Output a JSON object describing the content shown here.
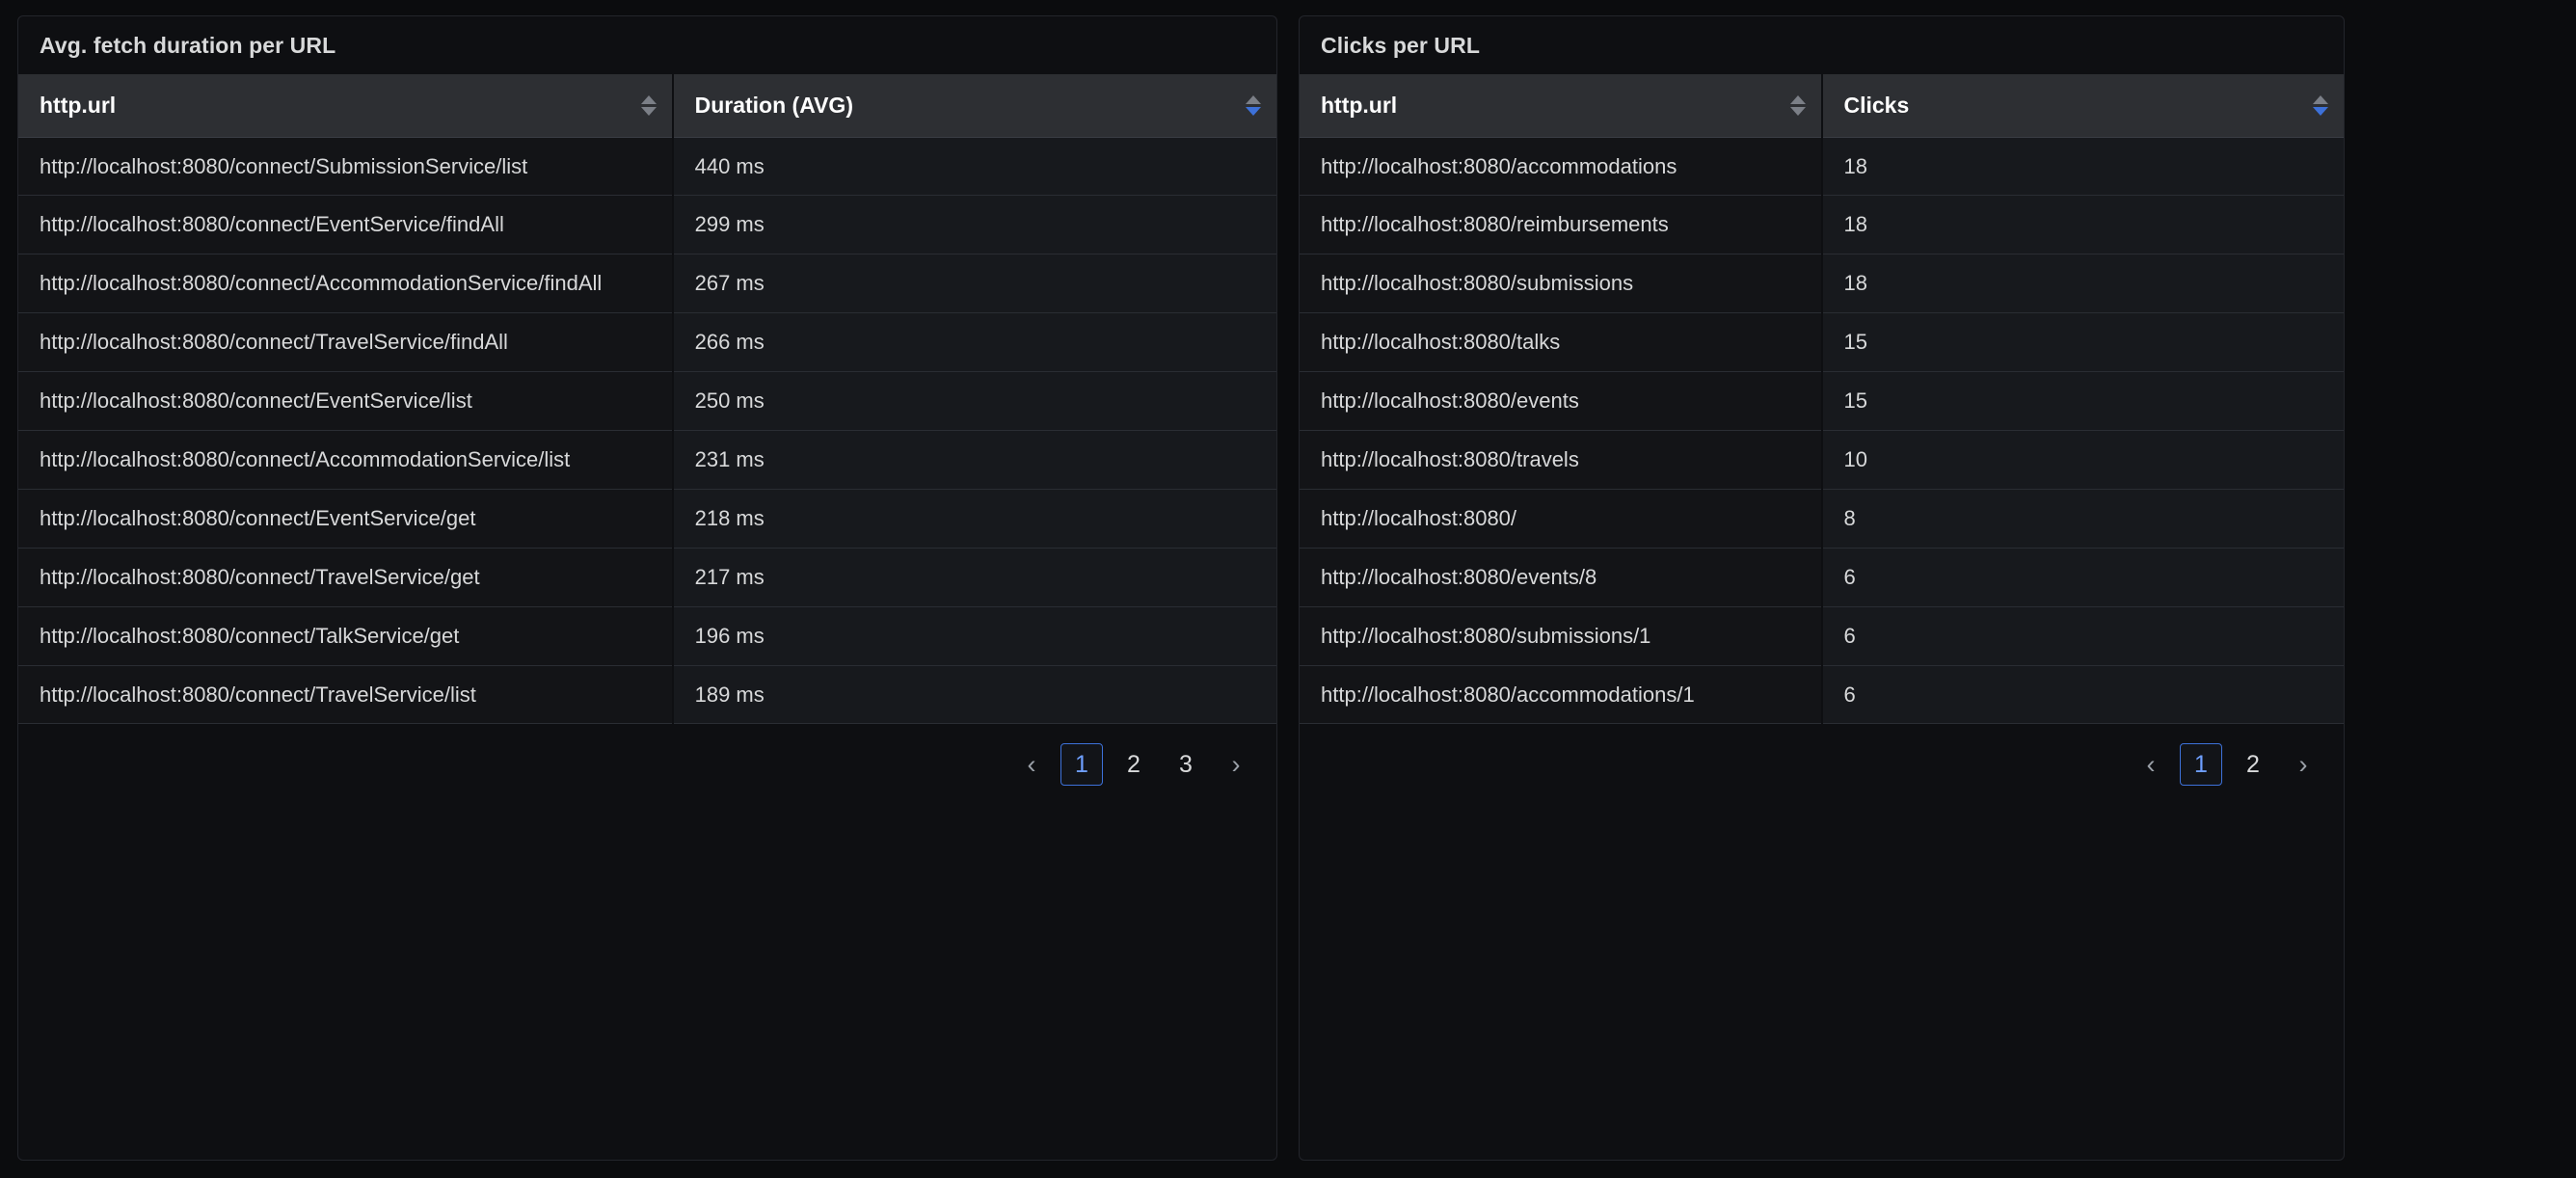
{
  "background_color": "#0b0c0e",
  "accent_color": "#3d71d9",
  "panels": [
    {
      "title": "Avg. fetch duration per URL",
      "columns": [
        {
          "label": "http.url",
          "sort": "none"
        },
        {
          "label": "Duration (AVG)",
          "sort": "desc"
        }
      ],
      "rows": [
        {
          "url": "http://localhost:8080/connect/SubmissionService/list",
          "value": "440 ms"
        },
        {
          "url": "http://localhost:8080/connect/EventService/findAll",
          "value": "299 ms"
        },
        {
          "url": "http://localhost:8080/connect/AccommodationService/findAll",
          "value": "267 ms"
        },
        {
          "url": "http://localhost:8080/connect/TravelService/findAll",
          "value": "266 ms"
        },
        {
          "url": "http://localhost:8080/connect/EventService/list",
          "value": "250 ms"
        },
        {
          "url": "http://localhost:8080/connect/AccommodationService/list",
          "value": "231 ms"
        },
        {
          "url": "http://localhost:8080/connect/EventService/get",
          "value": "218 ms"
        },
        {
          "url": "http://localhost:8080/connect/TravelService/get",
          "value": "217 ms"
        },
        {
          "url": "http://localhost:8080/connect/TalkService/get",
          "value": "196 ms"
        },
        {
          "url": "http://localhost:8080/connect/TravelService/list",
          "value": "189 ms"
        }
      ],
      "pagination": {
        "prev_label": "‹",
        "next_label": "›",
        "pages": [
          "1",
          "2",
          "3"
        ],
        "current": "1"
      }
    },
    {
      "title": "Clicks per URL",
      "columns": [
        {
          "label": "http.url",
          "sort": "none"
        },
        {
          "label": "Clicks",
          "sort": "desc"
        }
      ],
      "rows": [
        {
          "url": "http://localhost:8080/accommodations",
          "value": "18"
        },
        {
          "url": "http://localhost:8080/reimbursements",
          "value": "18"
        },
        {
          "url": "http://localhost:8080/submissions",
          "value": "18"
        },
        {
          "url": "http://localhost:8080/talks",
          "value": "15"
        },
        {
          "url": "http://localhost:8080/events",
          "value": "15"
        },
        {
          "url": "http://localhost:8080/travels",
          "value": "10"
        },
        {
          "url": "http://localhost:8080/",
          "value": "8"
        },
        {
          "url": "http://localhost:8080/events/8",
          "value": "6"
        },
        {
          "url": "http://localhost:8080/submissions/1",
          "value": "6"
        },
        {
          "url": "http://localhost:8080/accommodations/1",
          "value": "6"
        }
      ],
      "pagination": {
        "prev_label": "‹",
        "next_label": "›",
        "pages": [
          "1",
          "2"
        ],
        "current": "1"
      }
    }
  ]
}
